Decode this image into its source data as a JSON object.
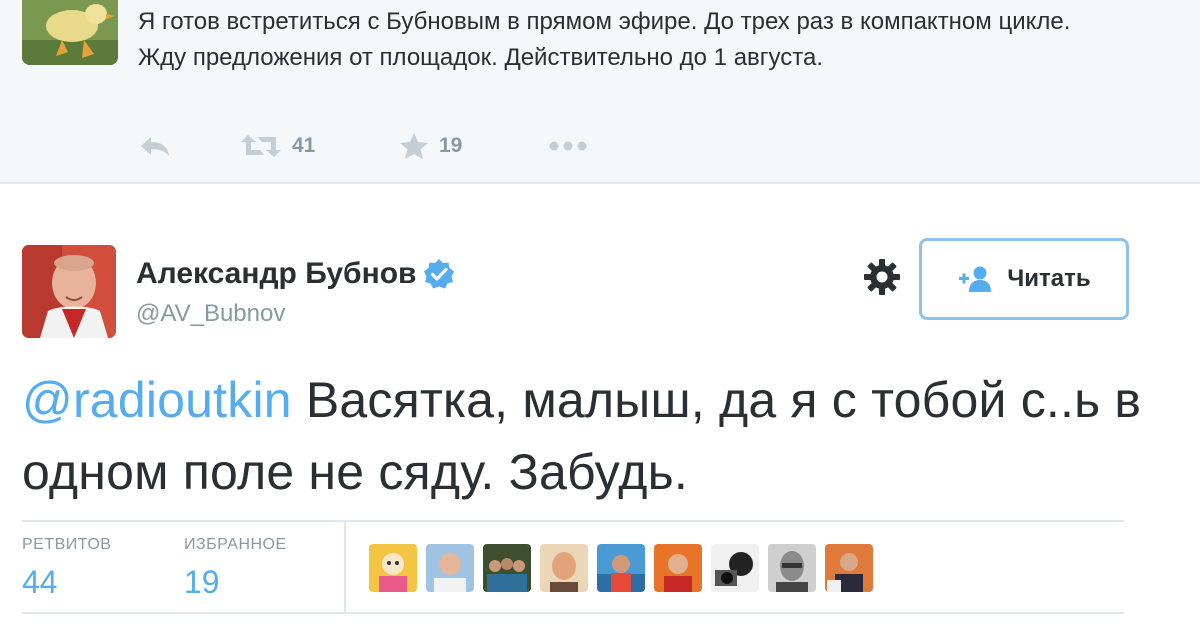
{
  "parent_tweet": {
    "text": "Я готов встретиться с Бубновым в прямом эфире. До трех раз в компактном цикле. Жду предложения от площадок. Действительно до 1 августа.",
    "retweets": "41",
    "favorites": "19",
    "icons": [
      "reply-icon",
      "retweet-icon",
      "star-icon",
      "more-icon"
    ]
  },
  "main_tweet": {
    "author_name": "Александр Бубнов",
    "author_handle": "@AV_Bubnov",
    "verified": true,
    "follow_label": "Читать",
    "text_mention": "@radioutkin",
    "text_body": " Васятка, малыш, да я с тобой с..ь в одном поле не сяду. Забудь.",
    "stats": {
      "retweets_label": "РЕТВИТОВ",
      "retweets_value": "44",
      "favorites_label": "ИЗБРАННОЕ",
      "favorites_value": "19"
    },
    "favorited_by_count": 9
  },
  "colors": {
    "accent": "#55acee",
    "text": "#292f33",
    "muted": "#8899a6",
    "border": "#e1e8ed",
    "follow_border": "#8ec2ea",
    "parent_bg": "#f5f8fa"
  }
}
